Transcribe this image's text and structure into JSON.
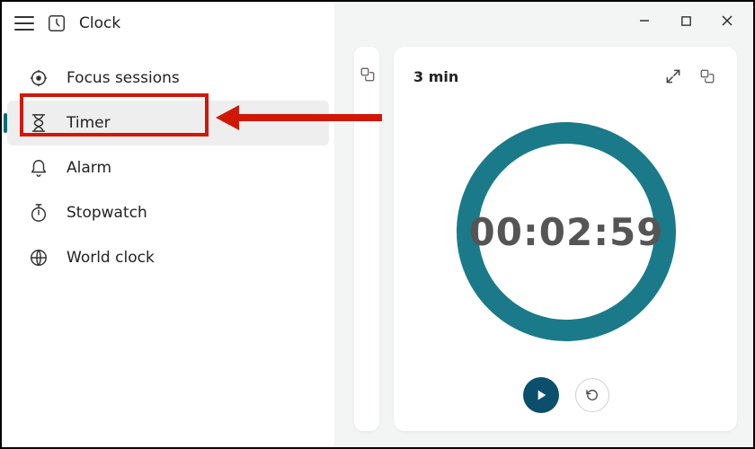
{
  "app": {
    "title": "Clock"
  },
  "nav": {
    "items": [
      {
        "label": "Focus sessions"
      },
      {
        "label": "Timer"
      },
      {
        "label": "Alarm"
      },
      {
        "label": "Stopwatch"
      },
      {
        "label": "World clock"
      }
    ],
    "selected_index": 1
  },
  "timer_card": {
    "title": "3 min",
    "time": "00:02:59"
  },
  "colors": {
    "ring": "#1b7a8a",
    "play_button": "#0b4f6c",
    "annotation": "#d11807"
  }
}
